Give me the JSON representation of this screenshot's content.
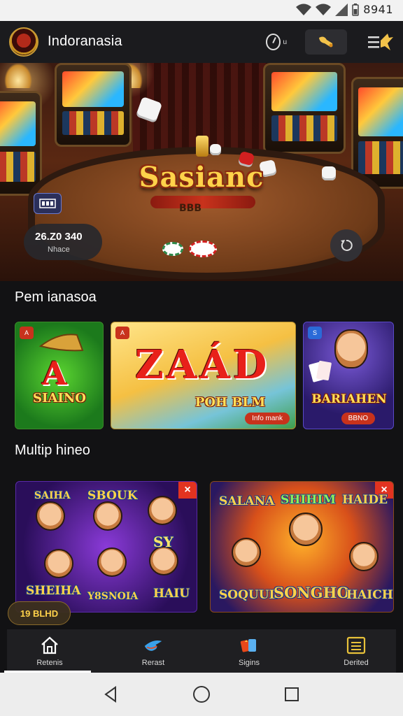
{
  "status_bar": {
    "time": "8941"
  },
  "app_bar": {
    "title": "Indoranasia",
    "clock_suffix": "u"
  },
  "hero": {
    "logo_text": "Sasianc",
    "table_text": "BBB",
    "counter_value": "26.Z0 340",
    "counter_label": "Nhace"
  },
  "section_promos": {
    "title": "Pem ianasoa",
    "cards": [
      {
        "badge": "A",
        "letter": "A",
        "word": "SIAINO"
      },
      {
        "badge": "A",
        "letter": "ZAÁD",
        "word": "POH BLM",
        "chip": "Info mank"
      },
      {
        "badge": "S",
        "word": "BARIAHEN",
        "chip": "BBNO"
      }
    ]
  },
  "section_games": {
    "title": "Multip hineo",
    "cards": [
      {
        "words": [
          "SAIHA",
          "SBOUK",
          "SHEIHA",
          "Y8SNOIA",
          "HAIU",
          "SY"
        ]
      },
      {
        "words": [
          "SALANA",
          "SHIHIM",
          "HAIDE",
          "SOQUUL",
          "SONGHO",
          "HAICHS"
        ]
      }
    ],
    "jackpot": "19 BLHD"
  },
  "bottom_nav": {
    "items": [
      {
        "label": "Retenis",
        "icon": "home-icon"
      },
      {
        "label": "Rerast",
        "icon": "bird-icon"
      },
      {
        "label": "Sigins",
        "icon": "cards-icon"
      },
      {
        "label": "Derited",
        "icon": "list-icon"
      }
    ]
  },
  "colors": {
    "accent_red": "#e23320",
    "gold": "#ffd24a",
    "background": "#121214"
  }
}
